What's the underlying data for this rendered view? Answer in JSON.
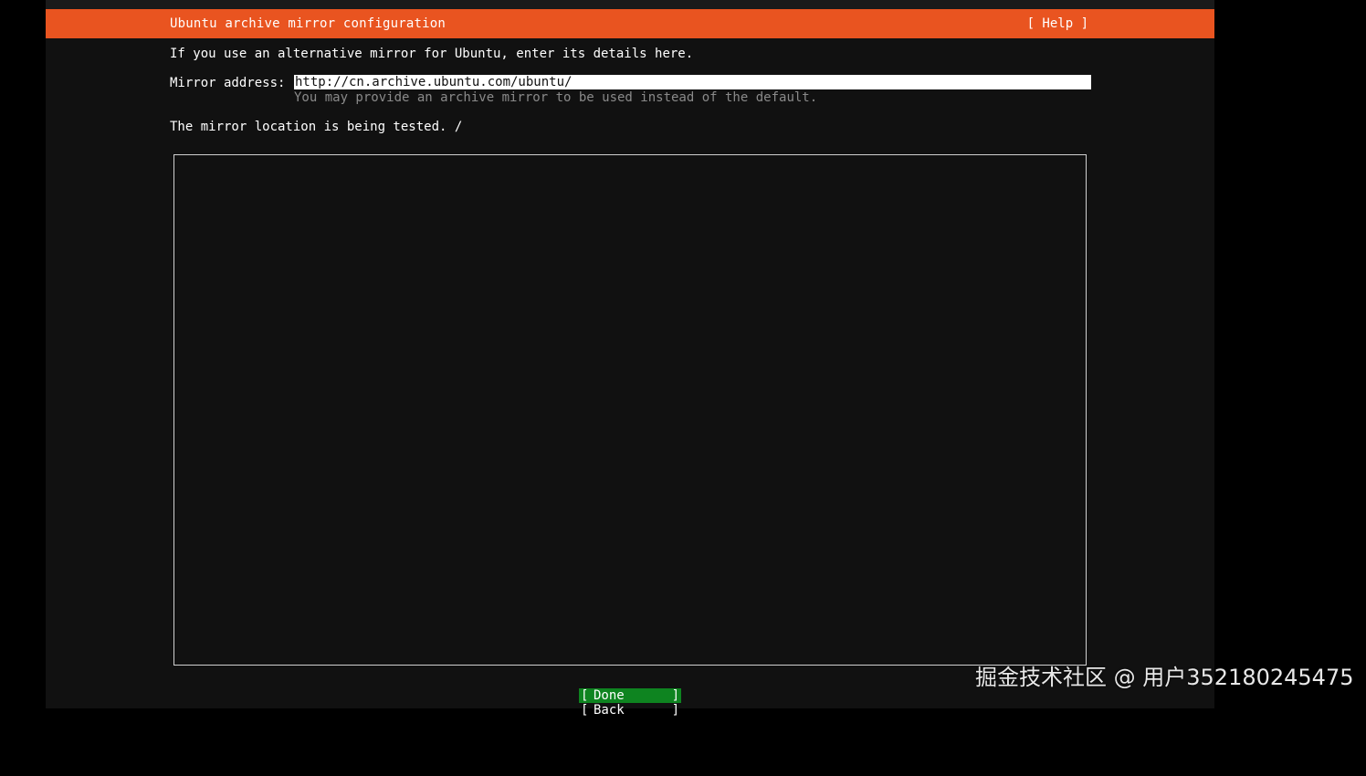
{
  "header": {
    "title": "Ubuntu archive mirror configuration",
    "help_label": "[ Help ]"
  },
  "intro_text": "If you use an alternative mirror for Ubuntu, enter its details here.",
  "mirror": {
    "label": "Mirror address:",
    "value": "http://cn.archive.ubuntu.com/ubuntu/",
    "hint": "You may provide an archive mirror to be used instead of the default."
  },
  "status_text": "The mirror location is being tested. /",
  "buttons": {
    "open_bracket": "[",
    "close_bracket": "]",
    "done_label": "Done",
    "back_label": "Back"
  },
  "watermark": "掘金技术社区 @ 用户352180245475",
  "colors": {
    "titlebar": "#e95420",
    "background": "#111111",
    "done_button": "#0e8420",
    "hint_text": "#8a8a8a"
  }
}
